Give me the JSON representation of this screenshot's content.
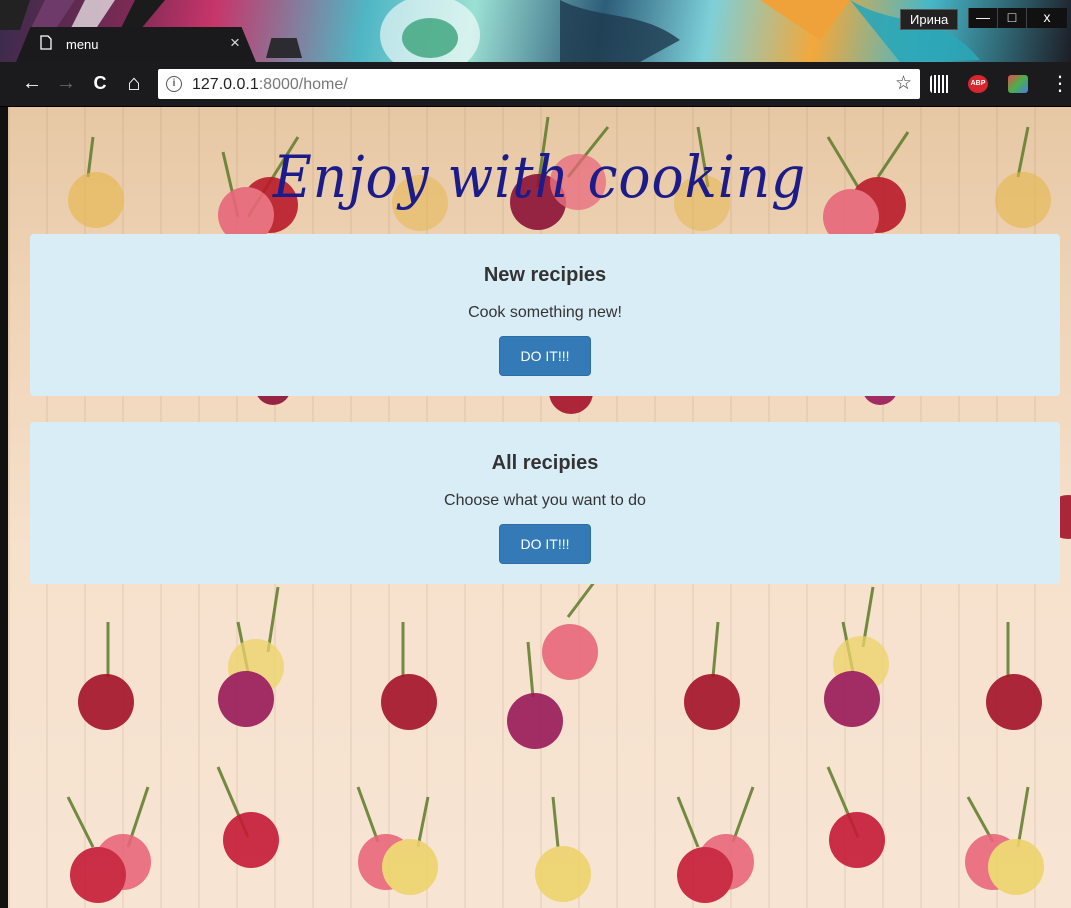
{
  "window": {
    "user_name": "Ирина",
    "minimize": "—",
    "maximize": "□",
    "close": "x"
  },
  "tab": {
    "title": "menu",
    "close": "×",
    "icon": "page-icon"
  },
  "toolbar": {
    "back": "←",
    "forward": "→",
    "reload": "C",
    "home": "⌂",
    "url_host": "127.0.0.1",
    "url_rest": ":8000/home/",
    "info": "i",
    "star": "☆",
    "abp_label": "ABP",
    "menu": "⋮"
  },
  "page": {
    "title": "Enjoy with cooking",
    "cards": [
      {
        "title": "New recipies",
        "text": "Cook something new!",
        "button": "DO IT!!!"
      },
      {
        "title": "All recipies",
        "text": "Choose what you want to do",
        "button": "DO IT!!!"
      }
    ]
  },
  "colors": {
    "card_bg": "#d9edf7",
    "button": "#337ab7",
    "title": "#1b1b8a"
  }
}
